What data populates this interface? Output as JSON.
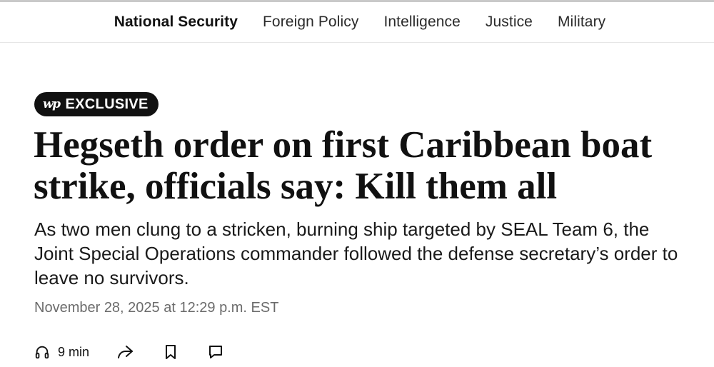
{
  "subnav": {
    "items": [
      {
        "label": "National Security",
        "active": true
      },
      {
        "label": "Foreign Policy",
        "active": false
      },
      {
        "label": "Intelligence",
        "active": false
      },
      {
        "label": "Justice",
        "active": false
      },
      {
        "label": "Military",
        "active": false
      }
    ]
  },
  "article": {
    "badge": {
      "logo": "wp",
      "label": "EXCLUSIVE"
    },
    "headline": "Hegseth order on first Caribbean boat strike, officials say: Kill them all",
    "dek": "As two men clung to a stricken, burning ship targeted by SEAL Team 6, the Joint Special Operations commander followed the defense secretary’s order to leave no survivors.",
    "timestamp": "November 28, 2025 at 12:29 p.m. EST"
  },
  "actions": {
    "listen": {
      "icon": "headphones-icon",
      "label": "9 min"
    },
    "share": {
      "icon": "share-icon"
    },
    "save": {
      "icon": "bookmark-icon"
    },
    "comments": {
      "icon": "comment-icon"
    }
  }
}
